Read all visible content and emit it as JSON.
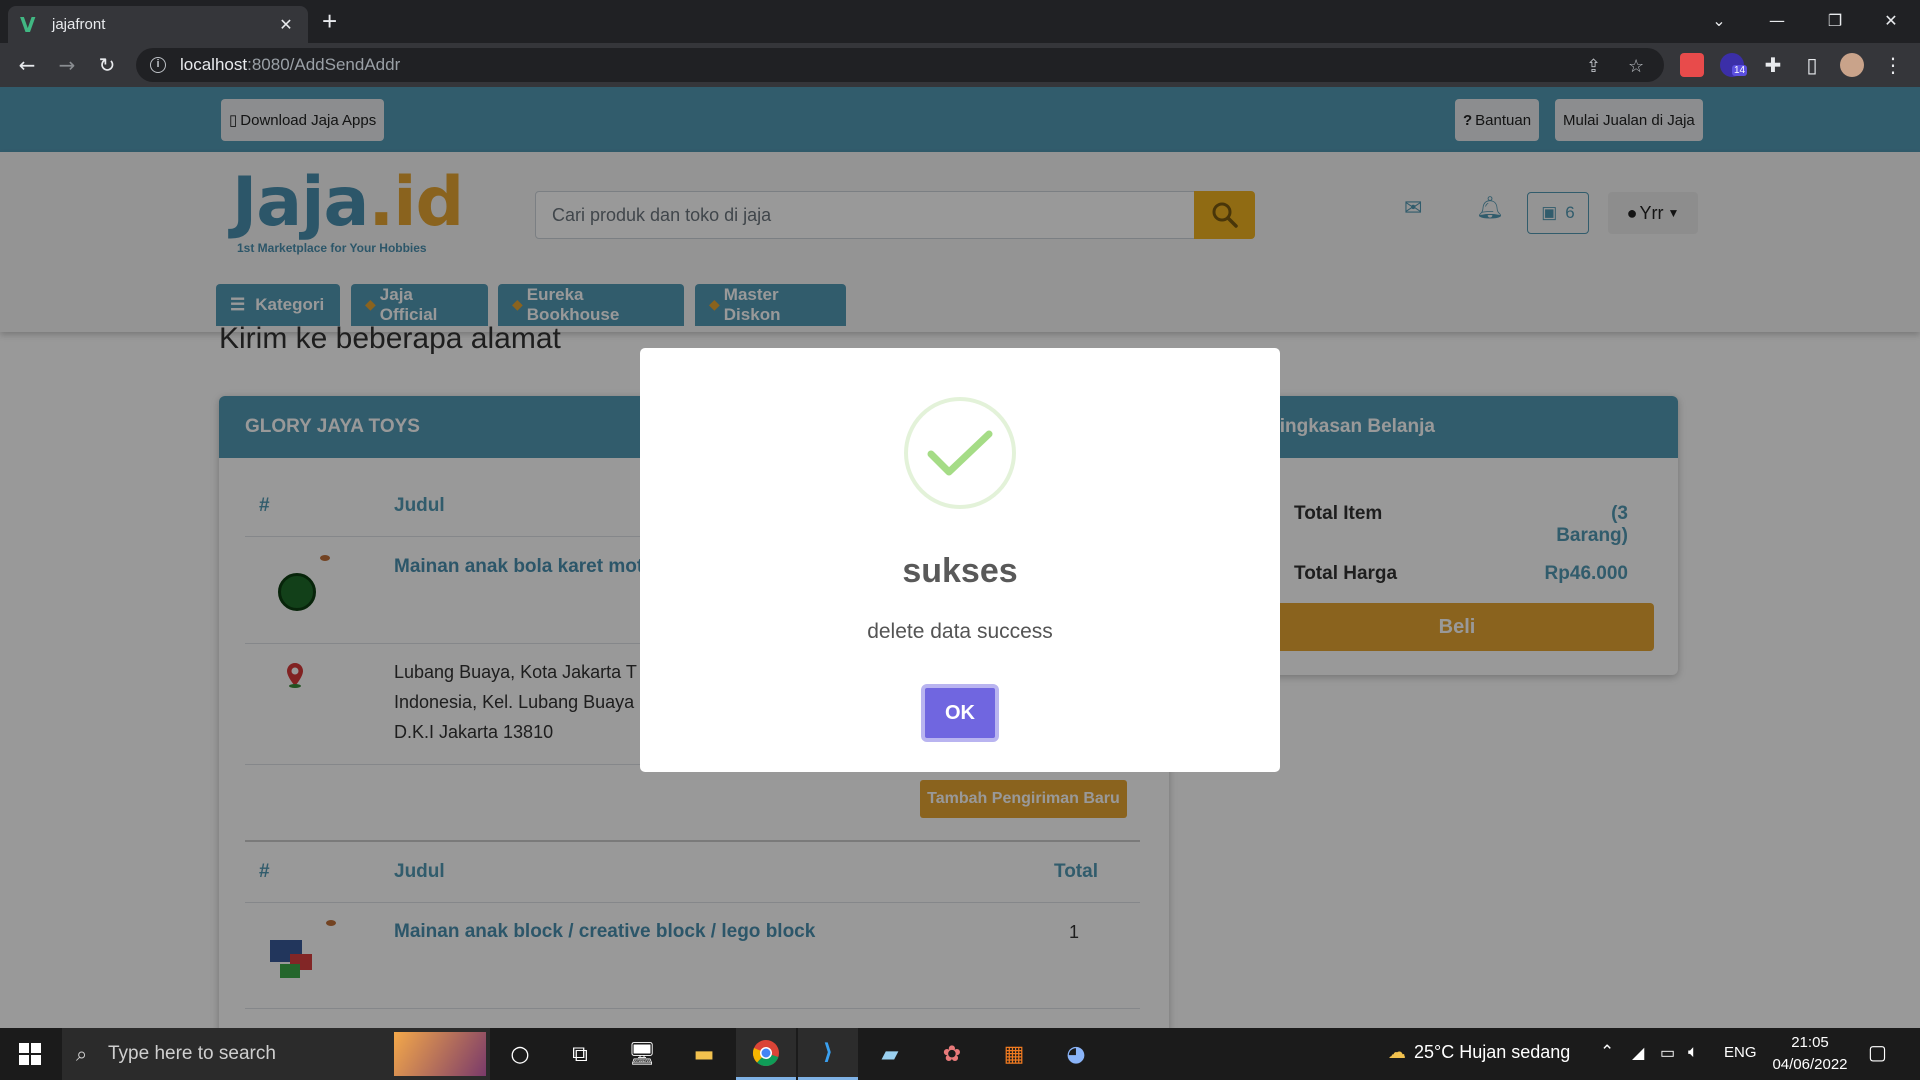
{
  "browser": {
    "tab_title": "jajafront",
    "url_host": "localhost",
    "url_path": ":8080/AddSendAddr"
  },
  "topbar": {
    "download_label": "Download Jaja Apps",
    "help_label": "Bantuan",
    "sell_label": "Mulai Jualan di Jaja"
  },
  "header": {
    "logo_main": "Jaja",
    "logo_dot": ".id",
    "logo_tagline": "1st Marketplace for Your Hobbies",
    "search_placeholder": "Cari produk dan toko di jaja",
    "cart_count": "6",
    "user_name": "Yrr"
  },
  "category_nav": {
    "items": [
      {
        "label": "Kategori"
      },
      {
        "label": "Jaja Official"
      },
      {
        "label": "Eureka Bookhouse"
      },
      {
        "label": "Master Diskon"
      }
    ]
  },
  "page": {
    "title": "Kirim ke beberapa alamat"
  },
  "store_card": {
    "store_name": "GLORY JAYA TOYS",
    "col_hash": "#",
    "col_title": "Judul",
    "col_total": "Total",
    "product1": "Mainan anak bola karet motif",
    "address_lines": [
      "Lubang Buaya, Kota Jakarta T",
      "Indonesia, Kel. Lubang Buaya",
      "D.K.I Jakarta 13810"
    ],
    "add_shipping_label": "Tambah Pengiriman Baru",
    "product2": "Mainan anak block / creative block / lego block",
    "product2_qty": "1"
  },
  "summary_card": {
    "title": "Ringkasan Belanja",
    "total_item_label": "Total Item",
    "total_item_value": "(3 Barang)",
    "total_price_label": "Total Harga",
    "total_price_value": "Rp46.000",
    "buy_label": "Beli"
  },
  "modal": {
    "title": "sukses",
    "message": "delete data success",
    "ok_label": "OK"
  },
  "taskbar": {
    "search_placeholder": "Type here to search",
    "weather": "25°C  Hujan sedang",
    "language": "ENG",
    "time": "21:05",
    "date": "04/06/2022"
  },
  "extensions": {
    "badge_count": "14"
  },
  "colors": {
    "primary": "#5399b4",
    "accent": "#e6a532",
    "confirm": "#7066e0",
    "success": "#a5dc86"
  }
}
